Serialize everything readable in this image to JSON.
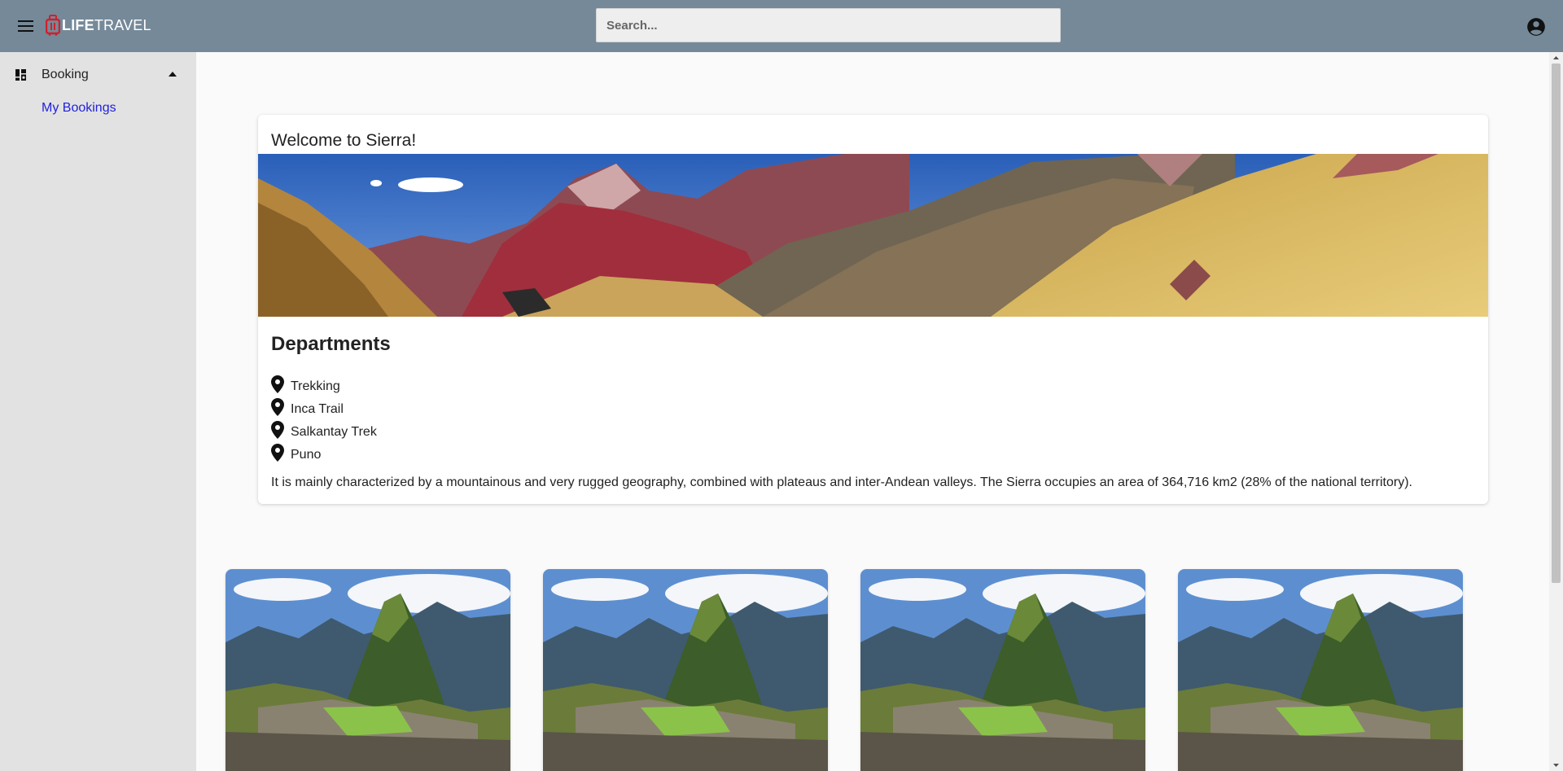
{
  "header": {
    "logo_bold": "LIFE",
    "logo_light": "TRAVEL",
    "search_placeholder": "Search..."
  },
  "sidebar": {
    "group_label": "Booking",
    "items": [
      {
        "label": "My Bookings"
      }
    ]
  },
  "main": {
    "welcome_title": "Welcome to Sierra!",
    "departments_heading": "Departments",
    "departments": [
      {
        "label": "Trekking"
      },
      {
        "label": "Inca Trail"
      },
      {
        "label": "Salkantay Trek"
      },
      {
        "label": "Puno"
      }
    ],
    "description": "It is mainly characterized by a mountainous and very rugged geography, combined with plateaus and inter-Andean valleys. The Sierra occupies an area of 364,716 km2 (28% of the national territory)."
  },
  "colors": {
    "appbar": "#758999",
    "sidebar": "#e2e2e2",
    "link": "#2222dd",
    "logo_accent": "#d0202a"
  }
}
